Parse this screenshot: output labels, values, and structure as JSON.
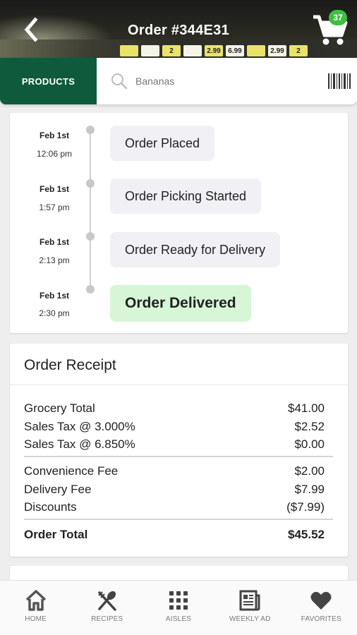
{
  "header": {
    "title": "Order #344E31",
    "cart_count": "37",
    "shelf_prices": [
      "",
      "",
      "2",
      "",
      "2.99",
      "6.99",
      "",
      "2.99",
      "2"
    ]
  },
  "search": {
    "category_label": "PRODUCTS",
    "placeholder": "Bananas"
  },
  "timeline": [
    {
      "date": "Feb 1st",
      "time": "12:06 pm",
      "status": "Order Placed"
    },
    {
      "date": "Feb 1st",
      "time": "1:57 pm",
      "status": "Order Picking Started"
    },
    {
      "date": "Feb 1st",
      "time": "2:13 pm",
      "status": "Order Ready for Delivery"
    },
    {
      "date": "Feb 1st",
      "time": "2:30 pm",
      "status": "Order Delivered"
    }
  ],
  "receipt": {
    "title": "Order Receipt",
    "lines": [
      {
        "label": "Grocery Total",
        "value": "$41.00"
      },
      {
        "label": "Sales Tax @ 3.000%",
        "value": "$2.52"
      },
      {
        "label": "Sales Tax @ 6.850%",
        "value": "$0.00"
      },
      {
        "label": "Convenience Fee",
        "value": "$2.00"
      },
      {
        "label": "Delivery Fee",
        "value": "$7.99"
      },
      {
        "label": "Discounts",
        "value": "($7.99)"
      }
    ],
    "total": {
      "label": "Order Total",
      "value": "$45.52"
    }
  },
  "nav": {
    "items": [
      {
        "label": "HOME",
        "icon": "home-icon"
      },
      {
        "label": "RECIPES",
        "icon": "fork-spoon-icon"
      },
      {
        "label": "AISLES",
        "icon": "grid-icon"
      },
      {
        "label": "WEEKLY AD",
        "icon": "newspaper-icon"
      },
      {
        "label": "FAVORITES",
        "icon": "heart-icon"
      }
    ]
  },
  "colors": {
    "brand_green": "#0f5a3c",
    "badge_green": "#3fbf3f",
    "delivered_bg": "#d7f5d7"
  }
}
